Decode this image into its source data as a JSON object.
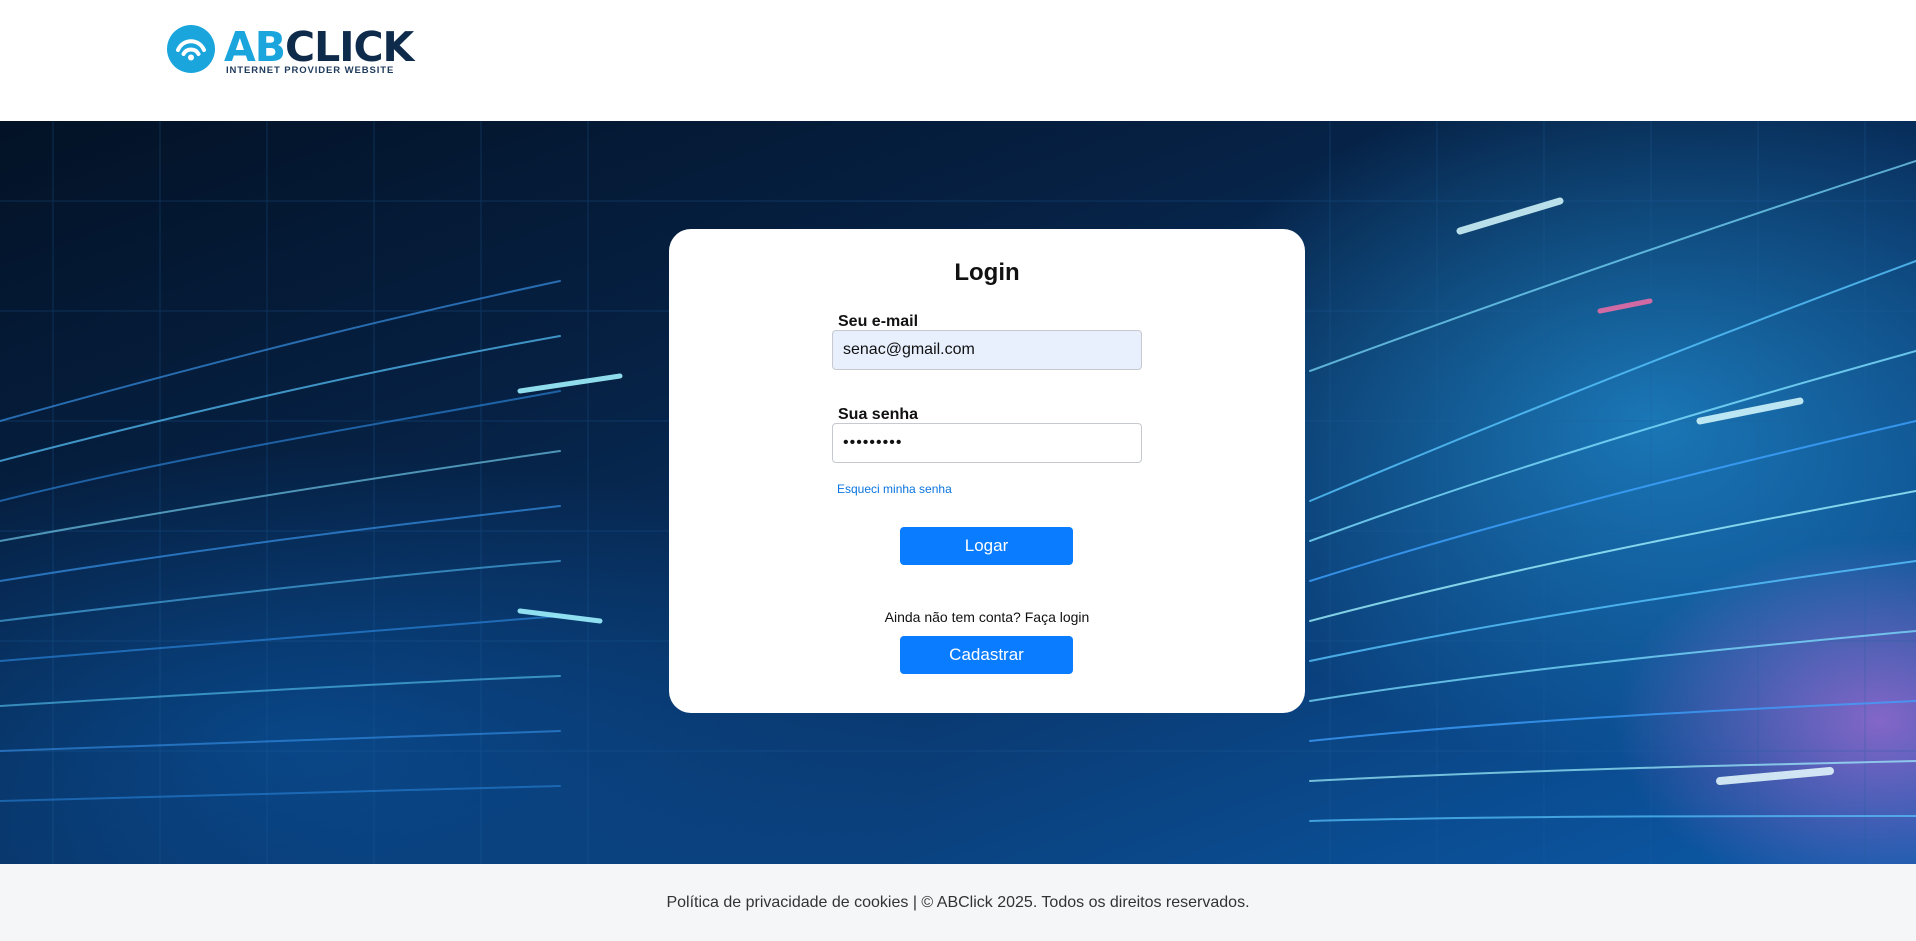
{
  "header": {
    "logo_text_ab": "AB",
    "logo_text_click": "CLICK",
    "logo_tagline": "INTERNET PROVIDER WEBSITE"
  },
  "login": {
    "title": "Login",
    "email_label": "Seu e-mail",
    "email_value": "senac@gmail.com",
    "password_label": "Sua senha",
    "password_value": "•••••••••",
    "forgot_link": "Esqueci minha senha",
    "login_button": "Logar",
    "signup_prompt": "Ainda não tem conta? Faça login",
    "signup_button": "Cadastrar"
  },
  "footer": {
    "text": "Política de privacidade de cookies | © ABClick 2025. Todos os direitos reservados."
  },
  "colors": {
    "primary_button": "#0a7cff",
    "link": "#0a74e0",
    "logo_navy": "#0f2b4c",
    "logo_cyan": "#1aa6dc",
    "email_autofill_bg": "#e8f0fe"
  },
  "icons": {
    "logo_mark": "wifi-signal-icon"
  }
}
